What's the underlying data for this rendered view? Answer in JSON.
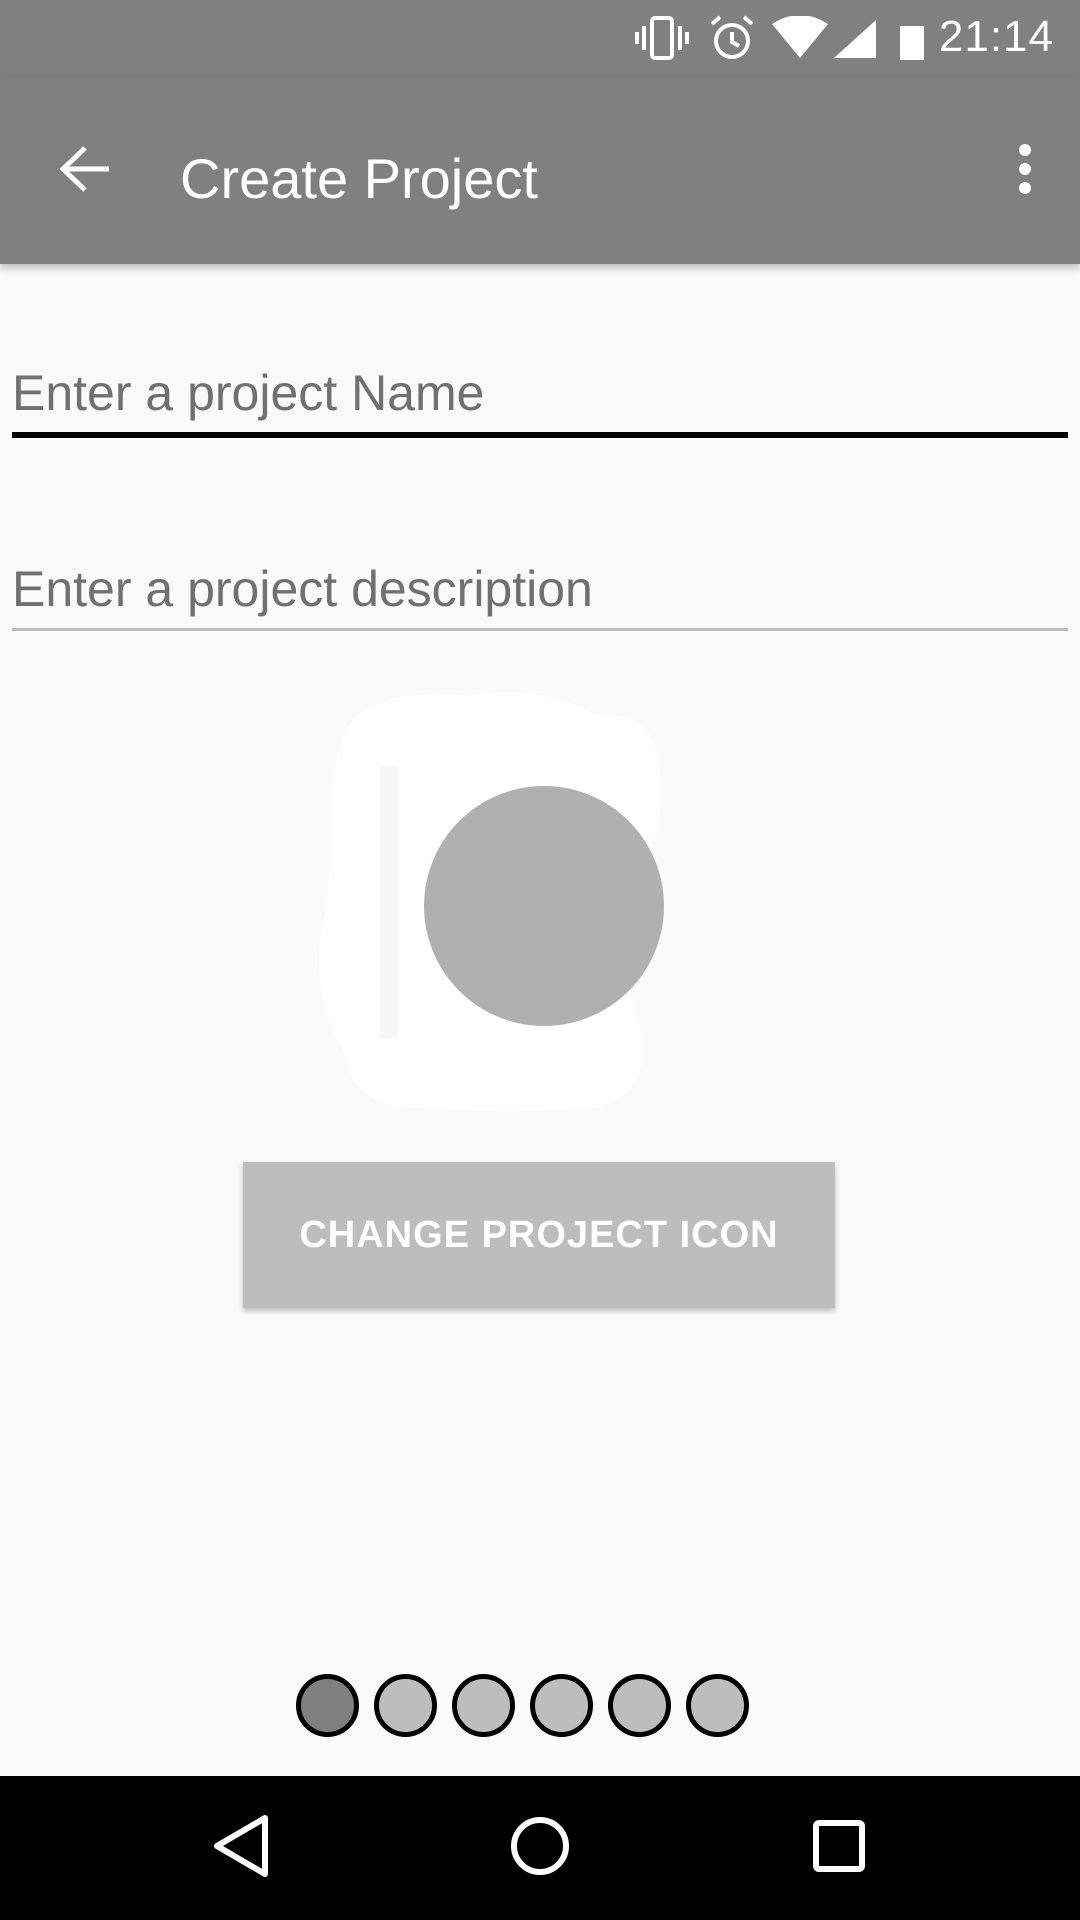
{
  "status_bar": {
    "time": "21:14",
    "icons": [
      "vibrate-icon",
      "alarm-icon",
      "wifi-icon",
      "cellular-signal-icon",
      "battery-icon"
    ]
  },
  "app_bar": {
    "title": "Create Project",
    "back_icon": "arrow-back-icon",
    "overflow_icon": "more-vert-icon"
  },
  "form": {
    "name_placeholder": "Enter a project Name",
    "name_value": "",
    "description_placeholder": "Enter a project description",
    "description_value": ""
  },
  "icon_preview": {
    "icon": "project-icon-placeholder"
  },
  "actions": {
    "change_icon_label": "CHANGE PROJECT ICON"
  },
  "pager": {
    "total_pages": 6,
    "current_page": 1
  },
  "nav_bar": {
    "icons": [
      "nav-back-icon",
      "nav-home-icon",
      "nav-recents-icon"
    ]
  },
  "colors": {
    "app_bar": "#808080",
    "background": "#fafafa",
    "button": "#bdbdbd",
    "dot_active": "#808080",
    "dot_inactive": "#bdbdbd"
  }
}
